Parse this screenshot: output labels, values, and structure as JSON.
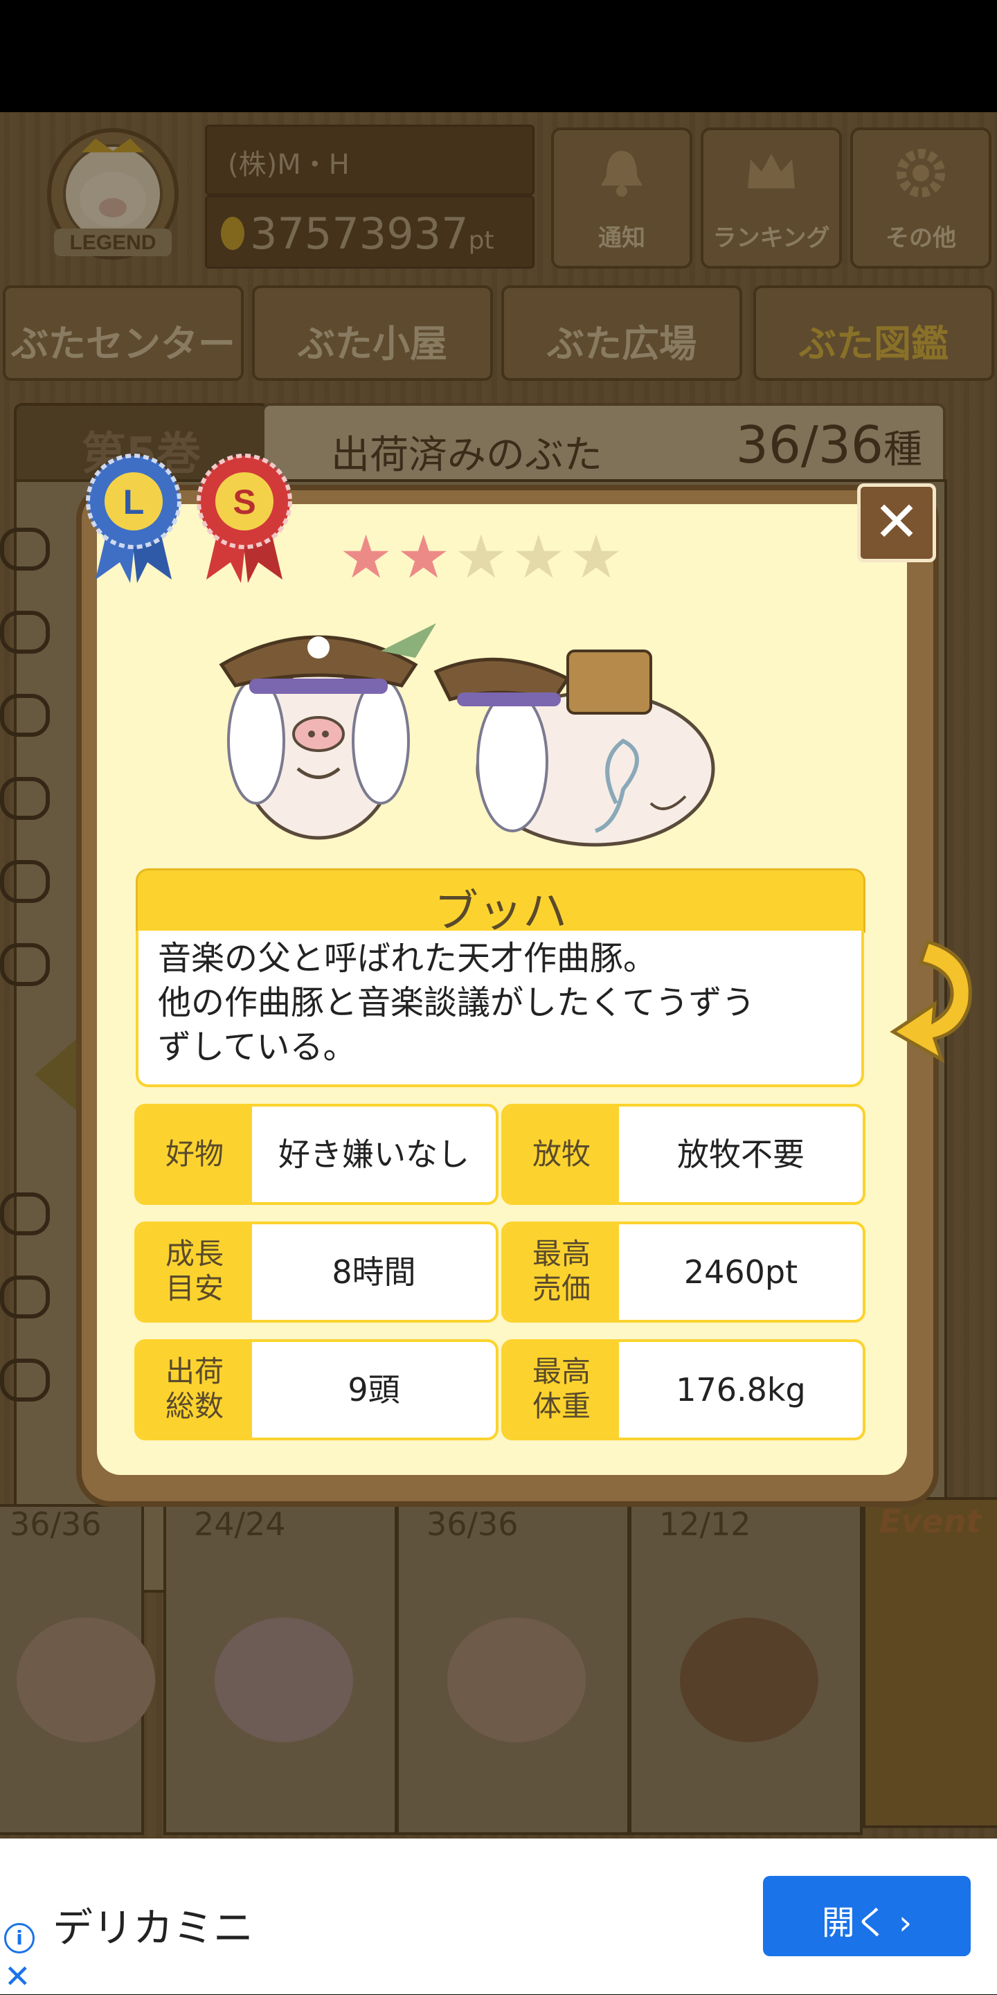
{
  "header": {
    "rank_badge": "LEGEND",
    "player_name": "(株)M・H",
    "points_value": "37573937",
    "points_unit": "pt",
    "buttons": [
      {
        "label": "通知",
        "icon": "bell-icon"
      },
      {
        "label": "ランキング",
        "icon": "crown-icon"
      },
      {
        "label": "その他",
        "icon": "gear-icon"
      }
    ]
  },
  "tabs": [
    "ぶたセンター",
    "ぶた小屋",
    "ぶた広場",
    "ぶた図鑑"
  ],
  "active_tab": "ぶた図鑑",
  "book": {
    "volume": "第5巻",
    "shipped_label": "出荷済みのぶた",
    "shipped_count": "36/36",
    "shipped_unit": "種"
  },
  "volumes": [
    {
      "count": "36/36"
    },
    {
      "count": "24/24"
    },
    {
      "count": "36/36"
    },
    {
      "count": "12/12"
    },
    {
      "count": "Event"
    }
  ],
  "dialog": {
    "ribbons": [
      "L",
      "S"
    ],
    "stars": {
      "filled": 2,
      "total": 5
    },
    "pig_name": "ブッハ",
    "description_line1": "音楽の父と呼ばれた天才作曲豚。",
    "description_line2": "他の作曲豚と音楽談議がしたくてうずう",
    "description_line3": "ずしている。",
    "stats": [
      {
        "key1": "好物",
        "key2": "",
        "value": "好き嫌いなし"
      },
      {
        "key1": "放牧",
        "key2": "",
        "value": "放牧不要"
      },
      {
        "key1": "成長",
        "key2": "目安",
        "value": "8時間"
      },
      {
        "key1": "最高",
        "key2": "売価",
        "value": "2460pt"
      },
      {
        "key1": "出荷",
        "key2": "総数",
        "value": "9頭"
      },
      {
        "key1": "最高",
        "key2": "体重",
        "value": "176.8kg"
      }
    ],
    "close_label": "✕"
  },
  "ad": {
    "title": "デリカミニ",
    "button_label": "開く ›",
    "info_label": "i",
    "close_label": "✕"
  },
  "colors": {
    "accent_yellow": "#fcd32e",
    "panel_bg": "#fef7c6",
    "star_filled": "#ec8a88",
    "star_empty": "#e4d9a8",
    "ad_button": "#1a73e8"
  }
}
